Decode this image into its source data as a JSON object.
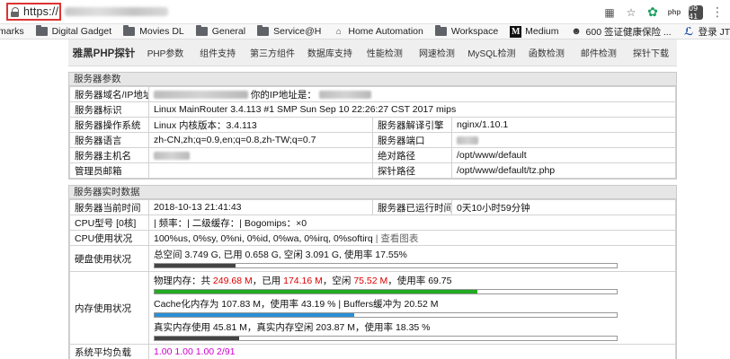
{
  "browser": {
    "url_scheme": "https://",
    "bookmarks": [
      {
        "label": "marks",
        "icon": "none"
      },
      {
        "label": "Digital Gadget",
        "icon": "folder-icon"
      },
      {
        "label": "Movies DL",
        "icon": "folder-icon"
      },
      {
        "label": "General",
        "icon": "folder-icon"
      },
      {
        "label": "Service@H",
        "icon": "folder-icon"
      },
      {
        "label": "Home Automation",
        "icon": "home-assistant-icon"
      },
      {
        "label": "Workspace",
        "icon": "folder-icon"
      },
      {
        "label": "Medium",
        "icon": "medium-icon"
      },
      {
        "label": "600 签证健康保险 ...",
        "icon": "qq-icon"
      },
      {
        "label": "登录 JTrac",
        "icon": "jtrac-icon"
      }
    ],
    "extension_badge": "09 41"
  },
  "nav": {
    "brand": "雅黑PHP探针",
    "items": [
      "PHP参数",
      "组件支持",
      "第三方组件",
      "数据库支持",
      "性能检测",
      "网速检测",
      "MySQL检测",
      "函数检测",
      "邮件检测",
      "探针下载"
    ]
  },
  "server_params": {
    "title": "服务器参数",
    "domain_label": "服务器域名/IP地址",
    "your_ip_label": "你的IP地址是：",
    "id_label": "服务器标识",
    "id_value": "Linux MainRouter 3.4.113 #1 SMP Sun Sep 10 22:26:27 CST 2017 mips",
    "os_label": "服务器操作系统",
    "os_value": "Linux  内核版本：3.4.113",
    "engine_label": "服务器解译引擎",
    "engine_value": "nginx/1.10.1",
    "lang_label": "服务器语言",
    "lang_value": "zh-CN,zh;q=0.9,en;q=0.8,zh-TW;q=0.7",
    "port_label": "服务器端口",
    "host_label": "服务器主机名",
    "abspath_label": "绝对路径",
    "abspath_value": "/opt/www/default",
    "admin_label": "管理员邮箱",
    "probe_label": "探针路径",
    "probe_value": "/opt/www/default/tz.php"
  },
  "realtime": {
    "title": "服务器实时数据",
    "time_label": "服务器当前时间",
    "time_value": "2018-10-13 21:41:43",
    "uptime_label": "服务器已运行时间",
    "uptime_value": "0天10小时59分钟",
    "cpu_model_label": "CPU型号 [0核]",
    "cpu_model_value": "| 频率：| 二级缓存：| Bogomips：×0",
    "cpu_usage_label": "CPU使用状况",
    "cpu_usage_value": "100%us, 0%sy, 0%ni, 0%id, 0%wa, 0%irq, 0%softirq",
    "cpu_usage_link": "| 查看图表",
    "disk_label": "硬盘使用状况",
    "disk_value": "总空间 3.749 G,   已用 0.658 G,   空闲 3.091 G,   使用率 17.55%",
    "disk_pct": 17.55,
    "mem_label": "内存使用状况",
    "mem_phys_prefix": "物理内存：共 ",
    "mem_total": "249.68 M",
    "mem_used_prefix": "，已用 ",
    "mem_used": "174.16 M",
    "mem_free_prefix": "，空闲 ",
    "mem_free": "75.52 M",
    "mem_rate_suffix": "，使用率 69.75",
    "mem_pct": 69.75,
    "cache_value": "Cache化内存为 107.83 M，使用率 43.19 % | Buffers缓冲为 20.52 M",
    "cache_pct": 43.19,
    "real_value": "真实内存使用 45.81 M，真实内存空闲 203.87 M，使用率 18.35 %",
    "real_pct": 18.35,
    "load_label": "系统平均负载",
    "load_value": "1.00 1.00 1.00 2/91"
  },
  "colors": {
    "disk_bar": "#444444",
    "mem_bar": "#22aa22",
    "cache_bar": "#2a8fd6",
    "real_bar": "#444444"
  }
}
